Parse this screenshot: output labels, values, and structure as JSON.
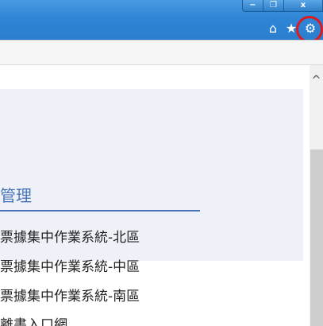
{
  "window": {
    "minimize_glyph": "−",
    "restore_glyph": "❐",
    "close_glyph": "x"
  },
  "toolbar": {
    "home_glyph": "⌂",
    "favorites_glyph": "★",
    "tools_glyph": "⚙"
  },
  "section": {
    "title": "管理",
    "links": [
      "票據集中作業系統-北區",
      "票據集中作業系統-中區",
      "票據集中作業系統-南區",
      "離書入口網"
    ]
  },
  "scrollbar": {
    "up_glyph": "^"
  },
  "colors": {
    "titlebar": "#2f86d6",
    "highlight": "#e0191e",
    "section_title": "#4a74b8"
  }
}
